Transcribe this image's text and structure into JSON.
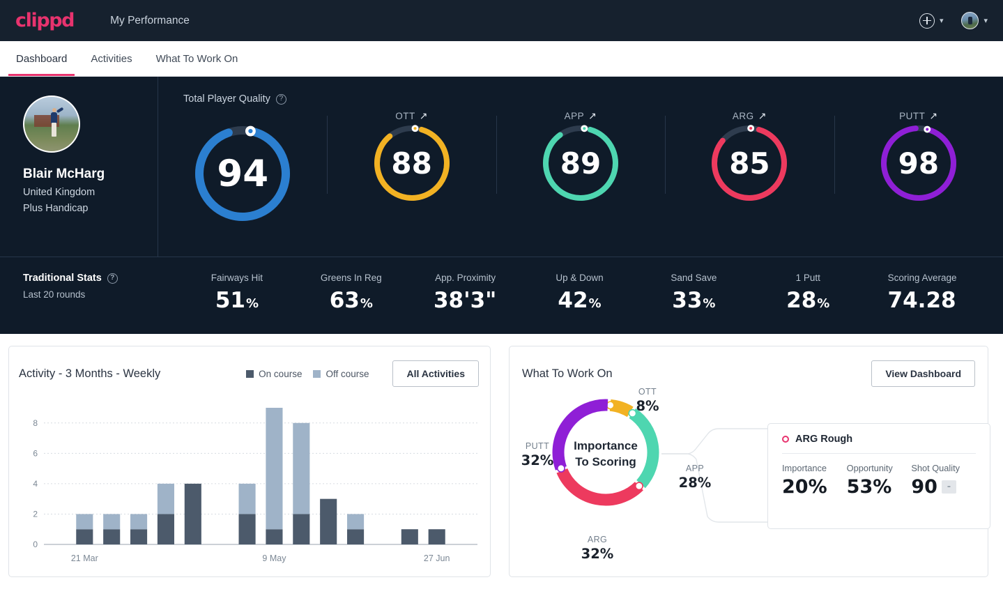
{
  "header": {
    "logo": "clippd",
    "title": "My Performance",
    "add_icon": "plus-circle-icon",
    "chevron_icon": "chevron-down-icon"
  },
  "tabs": [
    {
      "label": "Dashboard",
      "active": true
    },
    {
      "label": "Activities",
      "active": false
    },
    {
      "label": "What To Work On",
      "active": false
    }
  ],
  "player": {
    "name": "Blair McHarg",
    "country": "United Kingdom",
    "handicap": "Plus Handicap"
  },
  "tpq": {
    "title": "Total Player Quality",
    "help_icon": "?",
    "main": {
      "label": "",
      "value": "94",
      "color": "#2b7fd0",
      "pct": 94
    },
    "subs": [
      {
        "label": "OTT",
        "trend": "↗",
        "value": "88",
        "color": "#f2b223",
        "pct": 88
      },
      {
        "label": "APP",
        "trend": "↗",
        "value": "89",
        "color": "#4ed6b0",
        "pct": 89
      },
      {
        "label": "ARG",
        "trend": "↗",
        "value": "85",
        "color": "#ed3a5e",
        "pct": 85
      },
      {
        "label": "PUTT",
        "trend": "↗",
        "value": "98",
        "color": "#8f1fd6",
        "pct": 98
      }
    ]
  },
  "traditional": {
    "title": "Traditional Stats",
    "help_icon": "?",
    "subtitle": "Last 20 rounds",
    "stats": [
      {
        "name": "Fairways Hit",
        "value": "51",
        "unit": "%"
      },
      {
        "name": "Greens In Reg",
        "value": "63",
        "unit": "%"
      },
      {
        "name": "App. Proximity",
        "value": "38'3\"",
        "unit": ""
      },
      {
        "name": "Up & Down",
        "value": "42",
        "unit": "%"
      },
      {
        "name": "Sand Save",
        "value": "33",
        "unit": "%"
      },
      {
        "name": "1 Putt",
        "value": "28",
        "unit": "%"
      },
      {
        "name": "Scoring Average",
        "value": "74.28",
        "unit": ""
      }
    ]
  },
  "activity": {
    "title": "Activity - 3 Months - Weekly",
    "legend": [
      {
        "label": "On course",
        "color": "#4c5a6b"
      },
      {
        "label": "Off course",
        "color": "#9fb3c8"
      }
    ],
    "button": "All Activities"
  },
  "chart_data": {
    "type": "bar",
    "title": "Activity - 3 Months - Weekly",
    "stacked": true,
    "xlabel": "",
    "ylabel": "",
    "ylim": [
      0,
      9
    ],
    "yticks": [
      0,
      2,
      4,
      6,
      8
    ],
    "grid": true,
    "legend_position": "top-right",
    "tick_labels": [
      "21 Mar",
      "9 May",
      "27 Jun"
    ],
    "tick_indices": [
      1,
      8,
      14
    ],
    "categories": [
      "w1",
      "w2",
      "w3",
      "w4",
      "w5",
      "w6",
      "w7",
      "w8",
      "w9",
      "w10",
      "w11",
      "w12",
      "w13",
      "w14",
      "w15",
      "w16"
    ],
    "series": [
      {
        "name": "On course",
        "color": "#4c5a6b",
        "values": [
          0,
          1,
          1,
          1,
          2,
          4,
          0,
          2,
          1,
          2,
          3,
          1,
          0,
          1,
          1,
          0
        ]
      },
      {
        "name": "Off course",
        "color": "#9fb3c8",
        "values": [
          0,
          1,
          1,
          1,
          2,
          0,
          0,
          2,
          8,
          6,
          0,
          1,
          0,
          0,
          0,
          0
        ]
      }
    ]
  },
  "wtwo": {
    "title": "What To Work On",
    "button": "View Dashboard",
    "center_line1": "Importance",
    "center_line2": "To Scoring",
    "donut": {
      "type": "pie",
      "segments": [
        {
          "name": "OTT",
          "value": 8,
          "label": "8%",
          "color": "#f2b223"
        },
        {
          "name": "APP",
          "value": 28,
          "label": "28%",
          "color": "#4ed6b0"
        },
        {
          "name": "ARG",
          "value": 32,
          "label": "32%",
          "color": "#ed3a5e"
        },
        {
          "name": "PUTT",
          "value": 32,
          "label": "32%",
          "color": "#8f1fd6"
        }
      ]
    },
    "detail": {
      "marker_color": "#e8336e",
      "title": "ARG Rough",
      "stats": [
        {
          "name": "Importance",
          "value": "20%",
          "badge": ""
        },
        {
          "name": "Opportunity",
          "value": "53%",
          "badge": ""
        },
        {
          "name": "Shot Quality",
          "value": "90",
          "badge": "-"
        }
      ]
    }
  }
}
